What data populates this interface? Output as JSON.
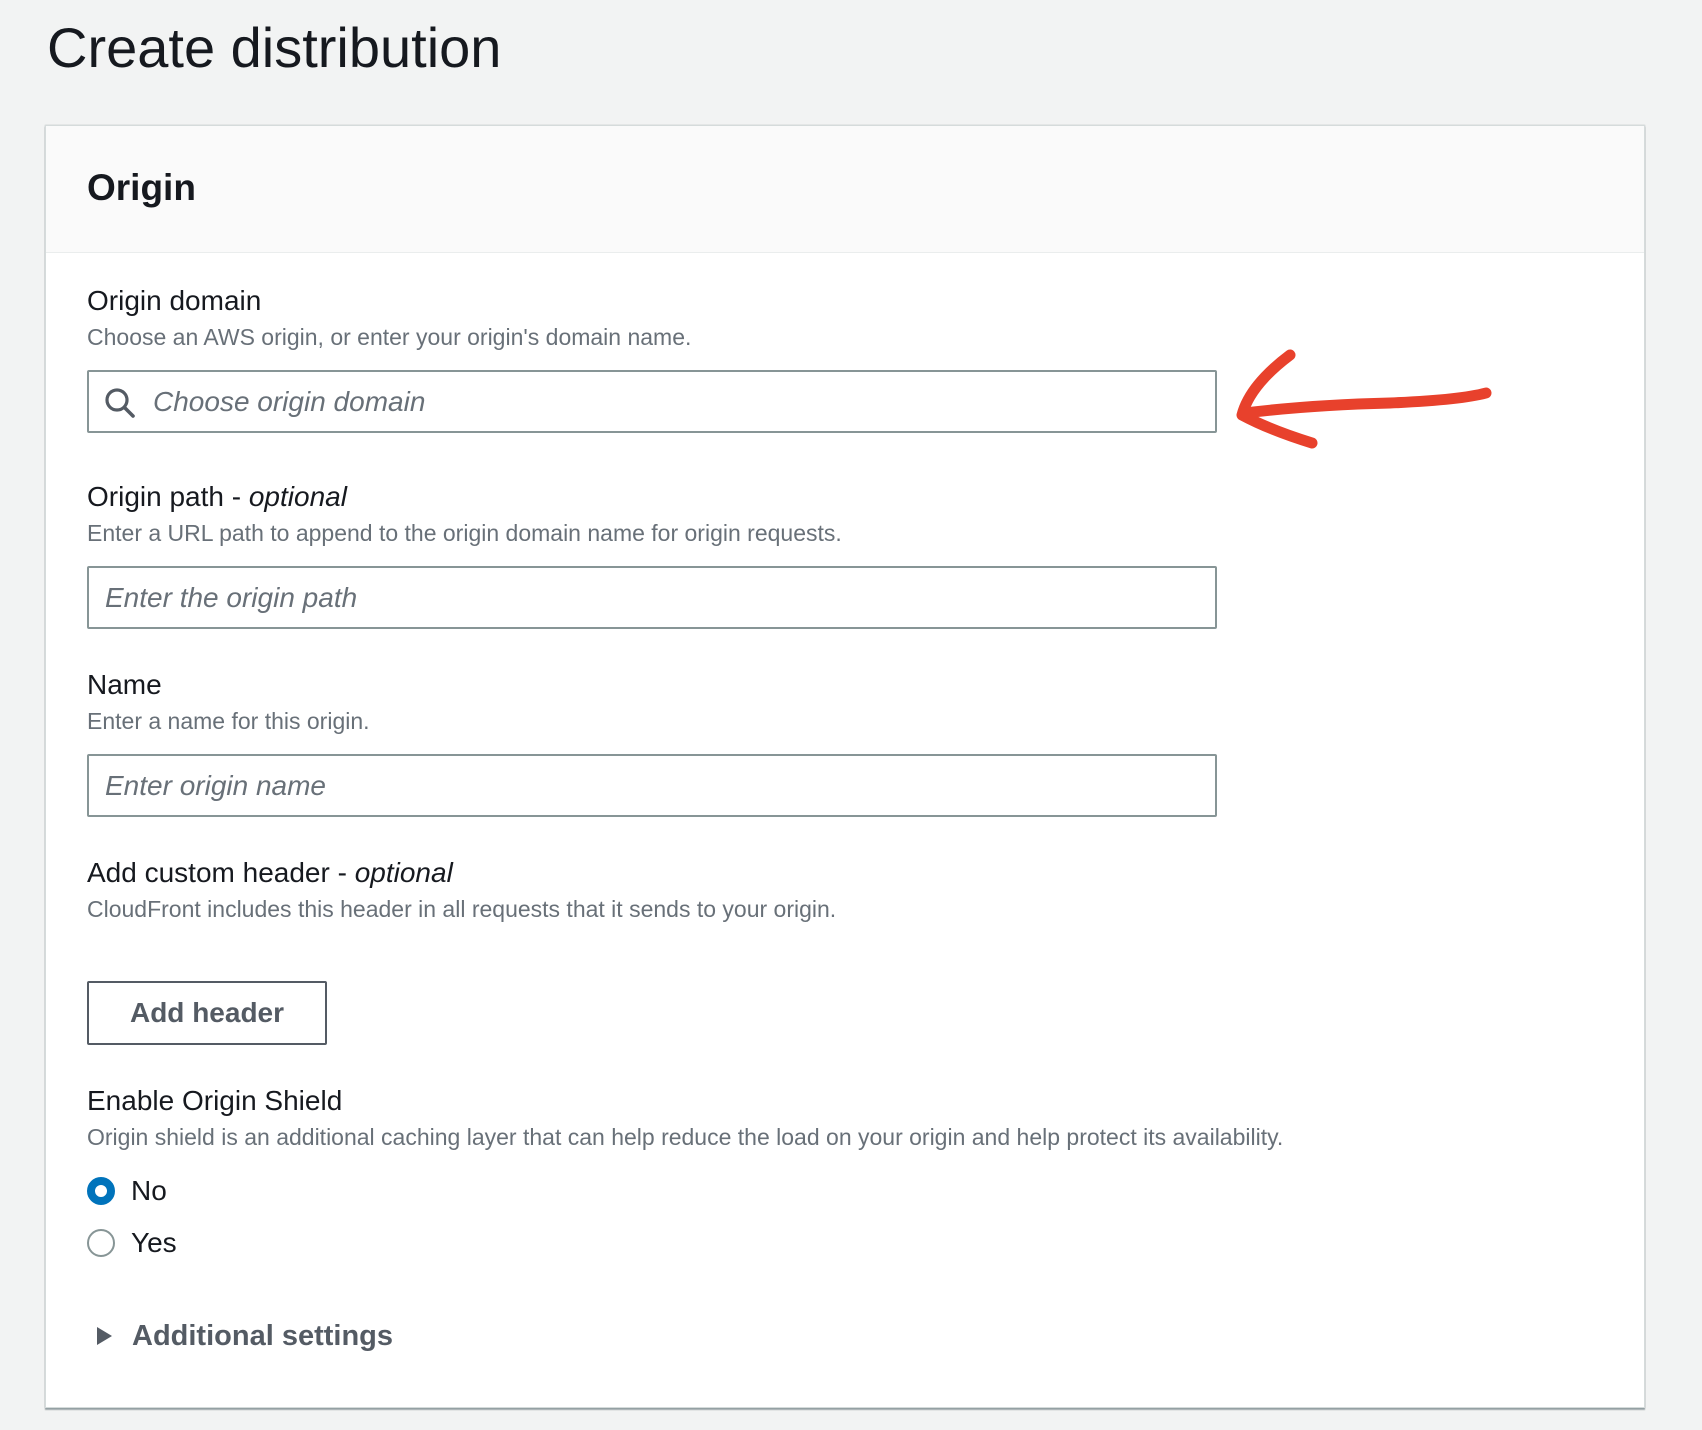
{
  "page": {
    "title": "Create distribution"
  },
  "origin_panel": {
    "title": "Origin",
    "origin_domain": {
      "label": "Origin domain",
      "description": "Choose an AWS origin, or enter your origin's domain name.",
      "placeholder": "Choose origin domain",
      "value": "",
      "icon": "search-icon"
    },
    "origin_path": {
      "label": "Origin path - ",
      "label_optional": "optional",
      "description": "Enter a URL path to append to the origin domain name for origin requests.",
      "placeholder": "Enter the origin path",
      "value": ""
    },
    "name": {
      "label": "Name",
      "description": "Enter a name for this origin.",
      "placeholder": "Enter origin name",
      "value": ""
    },
    "custom_header": {
      "label": "Add custom header - ",
      "label_optional": "optional",
      "description": "CloudFront includes this header in all requests that it sends to your origin.",
      "button_label": "Add header"
    },
    "origin_shield": {
      "label": "Enable Origin Shield",
      "description": "Origin shield is an additional caching layer that can help reduce the load on your origin and help protect its availability.",
      "options": [
        {
          "label": "No",
          "checked": true
        },
        {
          "label": "Yes",
          "checked": false
        }
      ]
    },
    "additional_settings": {
      "label": "Additional settings",
      "expanded": false,
      "icon": "caret-right-icon"
    }
  },
  "colors": {
    "page_bg": "#f2f3f3",
    "accent_blue": "#0073bb",
    "annotation_red": "#e8412c",
    "muted_text": "#687078"
  },
  "annotation": {
    "icon": "red-arrow-annotation-icon"
  }
}
